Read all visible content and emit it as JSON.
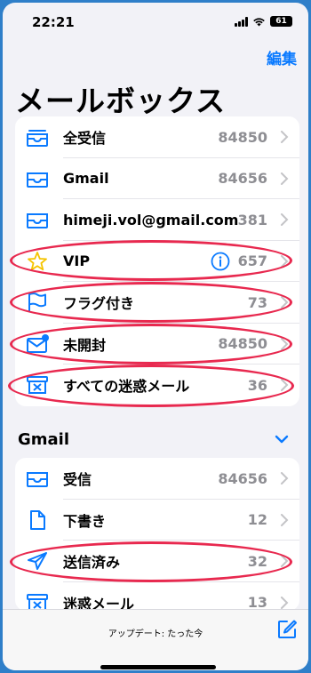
{
  "status": {
    "time": "22:21",
    "battery": "61"
  },
  "header": {
    "edit_label": "編集",
    "title": "メールボックス"
  },
  "mailboxes": [
    {
      "label": "全受信",
      "count": "84850",
      "icon": "tray-stack-icon"
    },
    {
      "label": "Gmail",
      "count": "84656",
      "icon": "tray-icon"
    },
    {
      "label": "himeji.vol@gmail.com",
      "count": "381",
      "icon": "tray-icon"
    },
    {
      "label": "VIP",
      "count": "657",
      "icon": "star-icon"
    },
    {
      "label": "フラグ付き",
      "count": "73",
      "icon": "flag-icon"
    },
    {
      "label": "未開封",
      "count": "84850",
      "icon": "envelope-unread-icon"
    },
    {
      "label": "すべての迷惑メール",
      "count": "36",
      "icon": "junk-icon"
    }
  ],
  "gmail_section": {
    "title": "Gmail",
    "items": [
      {
        "label": "受信",
        "count": "84656",
        "icon": "tray-icon"
      },
      {
        "label": "下書き",
        "count": "12",
        "icon": "document-icon"
      },
      {
        "label": "送信済み",
        "count": "32",
        "icon": "paperplane-icon"
      },
      {
        "label": "迷惑メール",
        "count": "13",
        "icon": "junk-icon"
      }
    ]
  },
  "bottom": {
    "update_text": "アップデート: たった今"
  },
  "colors": {
    "accent": "#0a7aff",
    "annotation": "#e8294f",
    "frame": "#2f7fc9"
  }
}
